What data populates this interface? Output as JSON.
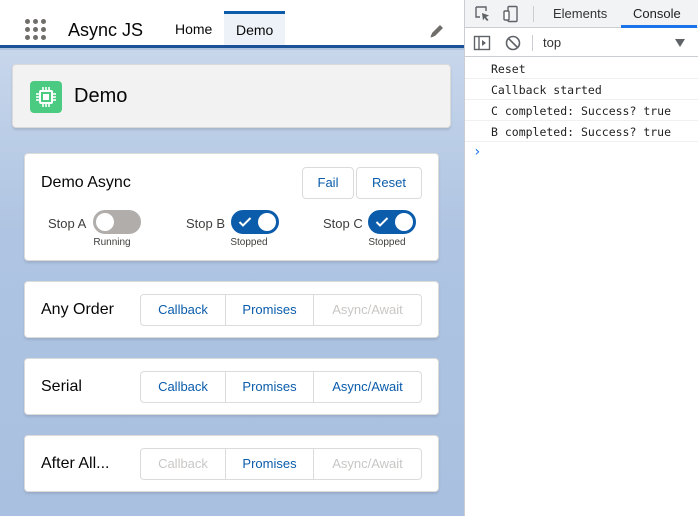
{
  "app": {
    "title": "Async JS",
    "nav": [
      {
        "label": "Home"
      },
      {
        "label": "Demo"
      }
    ],
    "header": {
      "title": "Demo"
    }
  },
  "demo_async": {
    "title": "Demo Async",
    "fail_label": "Fail",
    "reset_label": "Reset",
    "toggles": [
      {
        "label": "Stop A",
        "status": "Running",
        "on": false
      },
      {
        "label": "Stop B",
        "status": "Stopped",
        "on": true
      },
      {
        "label": "Stop C",
        "status": "Stopped",
        "on": true
      }
    ]
  },
  "sections": [
    {
      "title": "Any Order",
      "buttons": [
        {
          "label": "Callback",
          "enabled": true
        },
        {
          "label": "Promises",
          "enabled": true
        },
        {
          "label": "Async/Await",
          "enabled": false
        }
      ]
    },
    {
      "title": "Serial",
      "buttons": [
        {
          "label": "Callback",
          "enabled": true
        },
        {
          "label": "Promises",
          "enabled": true
        },
        {
          "label": "Async/Await",
          "enabled": true
        }
      ]
    },
    {
      "title": "After All...",
      "buttons": [
        {
          "label": "Callback",
          "enabled": false
        },
        {
          "label": "Promises",
          "enabled": true
        },
        {
          "label": "Async/Await",
          "enabled": false
        }
      ]
    }
  ],
  "devtools": {
    "tabs": [
      {
        "label": "Elements"
      },
      {
        "label": "Console"
      }
    ],
    "active_tab": "Console",
    "context": "top",
    "logs": [
      "Reset",
      "Callback started",
      "C completed: Success? true",
      "B completed: Success? true"
    ],
    "prompt": "›"
  },
  "colors": {
    "brand": "#0b5cab",
    "accent_green": "#4bca81",
    "nav_border": "#1b5297"
  }
}
